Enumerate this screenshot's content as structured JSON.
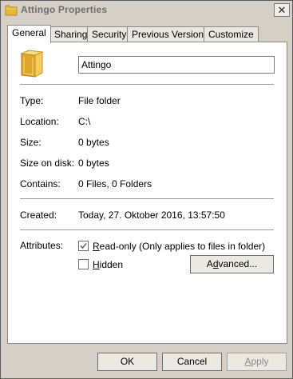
{
  "window": {
    "title": "Attingo Properties",
    "close_symbol": "✕"
  },
  "tabs": [
    {
      "label": "General",
      "active": true
    },
    {
      "label": "Sharing",
      "active": false
    },
    {
      "label": "Security",
      "active": false
    },
    {
      "label": "Previous Versions",
      "active": false
    },
    {
      "label": "Customize",
      "active": false
    }
  ],
  "general": {
    "folder_name": "Attingo",
    "type_label": "Type:",
    "type_value": "File folder",
    "location_label": "Location:",
    "location_value": "C:\\",
    "size_label": "Size:",
    "size_value": "0 bytes",
    "size_on_disk_label": "Size on disk:",
    "size_on_disk_value": "0 bytes",
    "contains_label": "Contains:",
    "contains_value": "0 Files, 0 Folders",
    "created_label": "Created:",
    "created_value": "Today, 27. Oktober 2016, 13:57:50",
    "attributes_label": "Attributes:",
    "readonly_label_accel": "R",
    "readonly_label_rest": "ead-only (Only applies to files in folder)",
    "readonly_checked": true,
    "hidden_label_accel": "H",
    "hidden_label_rest": "idden",
    "hidden_checked": false,
    "advanced_label_pre": "A",
    "advanced_label_accel": "d",
    "advanced_label_rest": "vanced..."
  },
  "footer": {
    "ok_label": "OK",
    "cancel_label": "Cancel",
    "apply_label_accel": "A",
    "apply_label_rest": "pply"
  },
  "icons": {
    "folder": "folder-icon",
    "close": "close-icon",
    "check": "checkmark-icon"
  }
}
